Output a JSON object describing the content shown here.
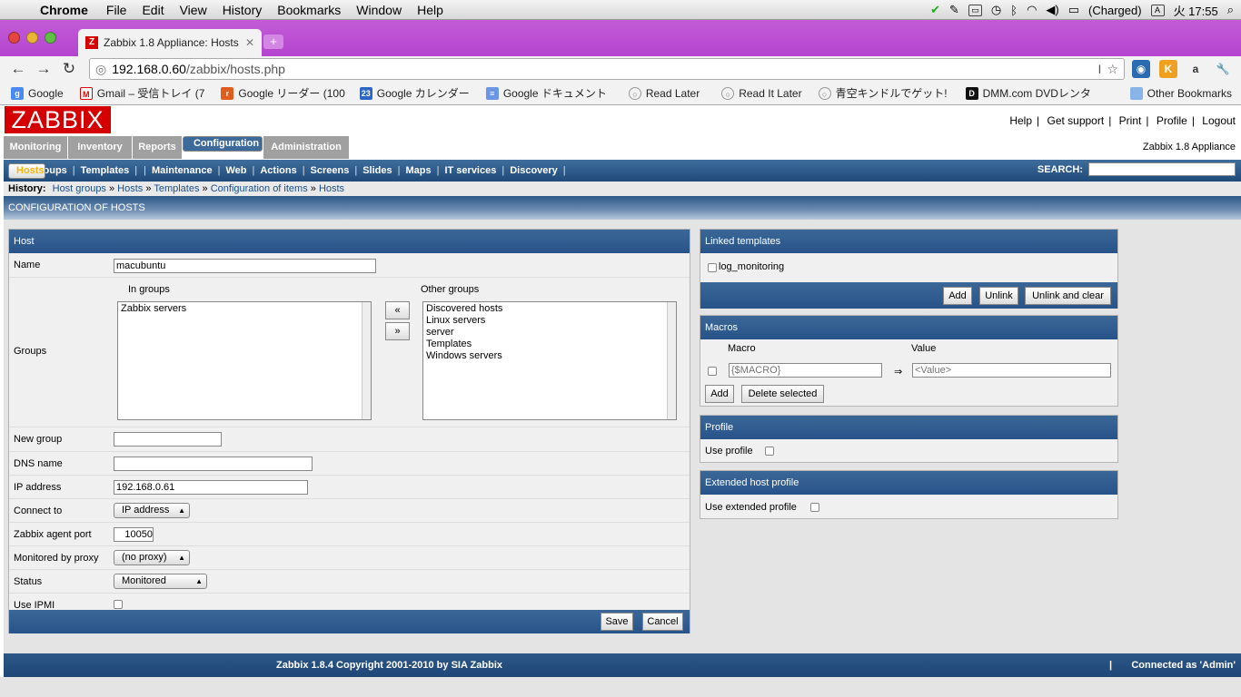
{
  "macmenu": {
    "app": "Chrome",
    "items": [
      "File",
      "Edit",
      "View",
      "History",
      "Bookmarks",
      "Window",
      "Help"
    ],
    "battery": "(Charged)",
    "input": "A",
    "clock": "火 17:55"
  },
  "browser": {
    "tab_title": "Zabbix 1.8 Appliance: Hosts",
    "url_host": "192.168.0.60",
    "url_path": "/zabbix/hosts.php",
    "bookmarks": [
      "Google",
      "Gmail – 受信トレイ (7",
      "Google リーダー (100",
      "Google カレンダー",
      "Google ドキュメント",
      "Read Later",
      "Read It Later",
      "青空キンドルでゲット!",
      "DMM.com DVDレンタ"
    ],
    "other_bookmarks": "Other Bookmarks"
  },
  "zabbix": {
    "logo": "ZABBIX",
    "top_links": [
      "Help",
      "Get support",
      "Print",
      "Profile",
      "Logout"
    ],
    "app_name": "Zabbix 1.8 Appliance",
    "main_tabs": [
      "Monitoring",
      "Inventory",
      "Reports",
      "Configuration",
      "Administration"
    ],
    "sub_menu": [
      "Host groups",
      "Templates",
      "Hosts",
      "Maintenance",
      "Web",
      "Actions",
      "Screens",
      "Slides",
      "Maps",
      "IT services",
      "Discovery"
    ],
    "search_label": "SEARCH:",
    "history_label": "History:",
    "history": [
      "Host groups",
      "Hosts",
      "Templates",
      "Configuration of items",
      "Hosts"
    ],
    "page_title": "CONFIGURATION OF HOSTS",
    "footer": "Zabbix 1.8.4 Copyright 2001-2010 by SIA Zabbix",
    "connected": "Connected as 'Admin'"
  },
  "host_form": {
    "title": "Host",
    "name_label": "Name",
    "name_value": "macubuntu",
    "groups_label": "Groups",
    "in_groups_label": "In groups",
    "in_groups": [
      "Zabbix servers"
    ],
    "other_groups_label": "Other groups",
    "other_groups": [
      "Discovered hosts",
      "Linux servers",
      "server",
      "Templates",
      "Windows servers"
    ],
    "move_left": "«",
    "move_right": "»",
    "new_group_label": "New group",
    "dns_label": "DNS name",
    "ip_label": "IP address",
    "ip_value": "192.168.0.61",
    "connect_label": "Connect to",
    "connect_value": "IP address",
    "port_label": "Zabbix agent port",
    "port_value": "10050",
    "proxy_label": "Monitored by proxy",
    "proxy_value": "(no proxy)",
    "status_label": "Status",
    "status_value": "Monitored",
    "ipmi_label": "Use IPMI",
    "save": "Save",
    "cancel": "Cancel"
  },
  "linked_templates": {
    "title": "Linked templates",
    "items": [
      "log_monitoring"
    ],
    "add": "Add",
    "unlink": "Unlink",
    "unlink_clear": "Unlink and clear"
  },
  "macros": {
    "title": "Macros",
    "col_macro": "Macro",
    "col_value": "Value",
    "macro_placeholder": "{$MACRO}",
    "value_placeholder": "<Value>",
    "arrow": "⇒",
    "add": "Add",
    "delete": "Delete selected"
  },
  "profile": {
    "title": "Profile",
    "label": "Use profile"
  },
  "ext_profile": {
    "title": "Extended host profile",
    "label": "Use extended profile"
  }
}
